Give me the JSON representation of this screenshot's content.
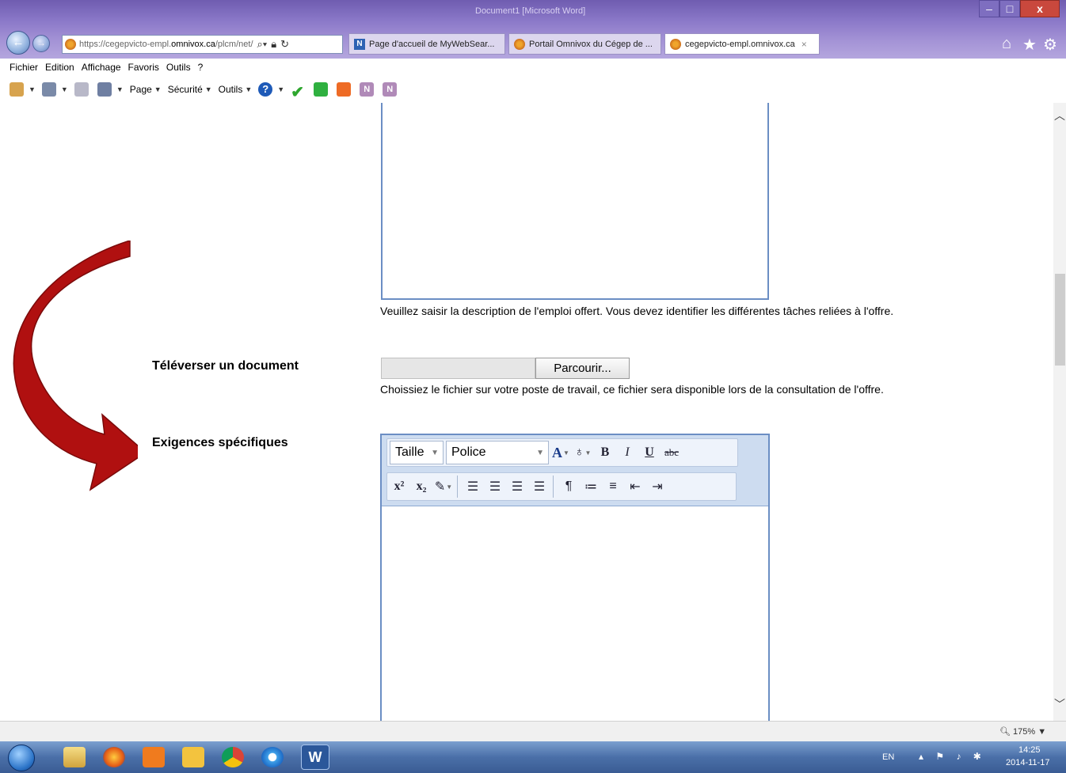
{
  "browser": {
    "window_title": "Document1 [Microsoft Word]",
    "address_url_prefix": "https://cegepvicto-empl.",
    "address_url_domain": "omnivox.ca",
    "address_url_suffix": "/plcm/net/",
    "address_icons": [
      "search-icon",
      "lock-icon",
      "refresh-icon"
    ],
    "tabs": [
      {
        "label": "Page d'accueil de MyWebSear...",
        "icon": "mywebsearch-icon",
        "active": false
      },
      {
        "label": "Portail Omnivox du Cégep de ...",
        "icon": "omnivox-icon",
        "active": false
      },
      {
        "label": "cegepvicto-empl.omnivox.ca",
        "icon": "omnivox-icon",
        "active": true
      }
    ],
    "tab_close_glyph": "×",
    "menu": [
      "Fichier",
      "Edition",
      "Affichage",
      "Favoris",
      "Outils",
      "?"
    ],
    "commands": {
      "page_label": "Page",
      "security_label": "Sécurité",
      "tools_label": "Outils"
    },
    "zoom": "175%"
  },
  "form": {
    "description_help": "Veuillez saisir la description de l'emploi offert. Vous devez identifier les différentes tâches reliées à l'offre.",
    "upload_label": "Téléverser un document",
    "upload_value": "",
    "browse_button": "Parcourir...",
    "upload_help": "Choissiez le fichier sur votre poste de travail, ce fichier sera disponible lors de la consultation de l'offre.",
    "requirements_label": "Exigences spécifiques",
    "requirements_value": "",
    "editor_toolbar": {
      "size_label": "Taille",
      "font_label": "Police"
    }
  },
  "annotation": {
    "arrow_color": "#b01010"
  },
  "taskbar": {
    "apps": [
      "windows-explorer",
      "firefox",
      "media-player",
      "outlook",
      "chrome",
      "internet-explorer",
      "word"
    ],
    "word_label": "W",
    "language": "EN",
    "time": "14:25",
    "date": "2014-11-17"
  }
}
